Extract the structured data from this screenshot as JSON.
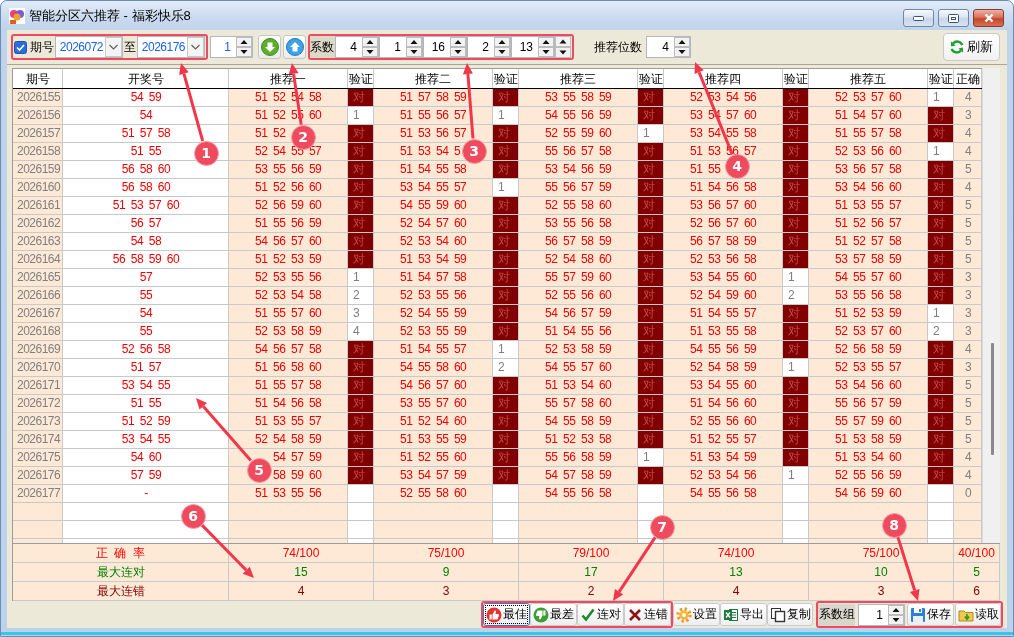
{
  "window": {
    "title": "智能分区六推荐 - 福彩快乐8"
  },
  "toolbar": {
    "period_filter": {
      "checked": true,
      "label": "期号",
      "from": "2026072",
      "to_label": "至",
      "to": "2026176"
    },
    "step": "1",
    "coefficients": {
      "label": "系数",
      "values": [
        "4",
        "1",
        "16",
        "2",
        "13"
      ]
    },
    "digits": {
      "label": "推荐位数",
      "value": "4"
    },
    "refresh_button": "刷新"
  },
  "table": {
    "columns": [
      "期号",
      "开奖号",
      "推荐一",
      "验证",
      "推荐二",
      "验证",
      "推荐三",
      "验证",
      "推荐四",
      "验证",
      "推荐五",
      "验证",
      "正确"
    ],
    "rows": [
      {
        "period": "2026155",
        "draw": "54 59",
        "picks": [
          {
            "numbers": "51 52 54 58",
            "check": "对",
            "hit": true
          },
          {
            "numbers": "51 57 58 59",
            "check": "对",
            "hit": true
          },
          {
            "numbers": "53 55 58 59",
            "check": "对",
            "hit": true
          },
          {
            "numbers": "52 53 54 56",
            "check": "对",
            "hit": true
          },
          {
            "numbers": "52 53 57 60",
            "check": "1",
            "hit": false
          }
        ],
        "correct": "4"
      },
      {
        "period": "2026156",
        "draw": "54",
        "picks": [
          {
            "numbers": "51 52 55 60",
            "check": "1",
            "hit": false
          },
          {
            "numbers": "51 55 56 57",
            "check": "1",
            "hit": false
          },
          {
            "numbers": "54 55 56 59",
            "check": "对",
            "hit": true
          },
          {
            "numbers": "53 54 57 60",
            "check": "对",
            "hit": true
          },
          {
            "numbers": "51 54 57 60",
            "check": "对",
            "hit": true
          }
        ],
        "correct": "3"
      },
      {
        "period": "2026157",
        "draw": "51 57 58",
        "picks": [
          {
            "numbers": "51 52",
            "check": "对",
            "hit": true
          },
          {
            "numbers": "51 53 56 57",
            "check": "对",
            "hit": true
          },
          {
            "numbers": "52 55 59 60",
            "check": "1",
            "hit": false
          },
          {
            "numbers": "53 54 55 58",
            "check": "对",
            "hit": true
          },
          {
            "numbers": "51 55 57 58",
            "check": "对",
            "hit": true
          }
        ],
        "correct": "4"
      },
      {
        "period": "2026158",
        "draw": "51 55",
        "picks": [
          {
            "numbers": "52 54 55 57",
            "check": "对",
            "hit": true
          },
          {
            "numbers": "51 53 54 5",
            "check": "对",
            "hit": true
          },
          {
            "numbers": "55 56 57 58",
            "check": "对",
            "hit": true
          },
          {
            "numbers": "51 53 56 57",
            "check": "对",
            "hit": true
          },
          {
            "numbers": "52 53 56 60",
            "check": "1",
            "hit": false
          }
        ],
        "correct": "4"
      },
      {
        "period": "2026159",
        "draw": "56 58 60",
        "picks": [
          {
            "numbers": "53 55 56 59",
            "check": "对",
            "hit": true
          },
          {
            "numbers": "51 54 55 58",
            "check": "对",
            "hit": true
          },
          {
            "numbers": "53 54 56 59",
            "check": "对",
            "hit": true
          },
          {
            "numbers": "51 55",
            "check": "对",
            "hit": true
          },
          {
            "numbers": "53 56 57 58",
            "check": "对",
            "hit": true
          }
        ],
        "correct": "5"
      },
      {
        "period": "2026160",
        "draw": "56 58 60",
        "picks": [
          {
            "numbers": "51 52 56 60",
            "check": "对",
            "hit": true
          },
          {
            "numbers": "53 54 55 57",
            "check": "1",
            "hit": false
          },
          {
            "numbers": "55 56 57 59",
            "check": "对",
            "hit": true
          },
          {
            "numbers": "51 54 56 58",
            "check": "对",
            "hit": true
          },
          {
            "numbers": "53 54 56 60",
            "check": "对",
            "hit": true
          }
        ],
        "correct": "4"
      },
      {
        "period": "2026161",
        "draw": "51 53 57 60",
        "picks": [
          {
            "numbers": "52 56 59 60",
            "check": "对",
            "hit": true
          },
          {
            "numbers": "54 55 59 60",
            "check": "对",
            "hit": true
          },
          {
            "numbers": "52 55 58 60",
            "check": "对",
            "hit": true
          },
          {
            "numbers": "53 56 57 60",
            "check": "对",
            "hit": true
          },
          {
            "numbers": "51 53 55 57",
            "check": "对",
            "hit": true
          }
        ],
        "correct": "5"
      },
      {
        "period": "2026162",
        "draw": "56 57",
        "picks": [
          {
            "numbers": "51 55 56 59",
            "check": "对",
            "hit": true
          },
          {
            "numbers": "52 54 57 60",
            "check": "对",
            "hit": true
          },
          {
            "numbers": "53 55 56 58",
            "check": "对",
            "hit": true
          },
          {
            "numbers": "52 56 57 60",
            "check": "对",
            "hit": true
          },
          {
            "numbers": "51 52 56 57",
            "check": "对",
            "hit": true
          }
        ],
        "correct": "5"
      },
      {
        "period": "2026163",
        "draw": "54 58",
        "picks": [
          {
            "numbers": "54 56 57 60",
            "check": "对",
            "hit": true
          },
          {
            "numbers": "52 53 54 60",
            "check": "对",
            "hit": true
          },
          {
            "numbers": "56 57 58 59",
            "check": "对",
            "hit": true
          },
          {
            "numbers": "56 57 58 59",
            "check": "对",
            "hit": true
          },
          {
            "numbers": "51 52 57 58",
            "check": "对",
            "hit": true
          }
        ],
        "correct": "5"
      },
      {
        "period": "2026164",
        "draw": "56 58 59 60",
        "picks": [
          {
            "numbers": "51 52 53 59",
            "check": "对",
            "hit": true
          },
          {
            "numbers": "51 53 54 59",
            "check": "对",
            "hit": true
          },
          {
            "numbers": "52 54 58 60",
            "check": "对",
            "hit": true
          },
          {
            "numbers": "52 53 56 58",
            "check": "对",
            "hit": true
          },
          {
            "numbers": "53 57 58 59",
            "check": "对",
            "hit": true
          }
        ],
        "correct": "5"
      },
      {
        "period": "2026165",
        "draw": "57",
        "picks": [
          {
            "numbers": "52 53 55 56",
            "check": "1",
            "hit": false
          },
          {
            "numbers": "51 54 57 58",
            "check": "对",
            "hit": true
          },
          {
            "numbers": "55 57 59 60",
            "check": "对",
            "hit": true
          },
          {
            "numbers": "53 54 55 60",
            "check": "1",
            "hit": false
          },
          {
            "numbers": "54 55 57 60",
            "check": "对",
            "hit": true
          }
        ],
        "correct": "3"
      },
      {
        "period": "2026166",
        "draw": "55",
        "picks": [
          {
            "numbers": "52 53 54 58",
            "check": "2",
            "hit": false
          },
          {
            "numbers": "52 53 55 56",
            "check": "对",
            "hit": true
          },
          {
            "numbers": "52 55 56 60",
            "check": "对",
            "hit": true
          },
          {
            "numbers": "52 54 59 60",
            "check": "2",
            "hit": false
          },
          {
            "numbers": "53 55 56 58",
            "check": "对",
            "hit": true
          }
        ],
        "correct": "3"
      },
      {
        "period": "2026167",
        "draw": "54",
        "picks": [
          {
            "numbers": "51 55 57 60",
            "check": "3",
            "hit": false
          },
          {
            "numbers": "52 54 55 59",
            "check": "对",
            "hit": true
          },
          {
            "numbers": "54 56 57 59",
            "check": "对",
            "hit": true
          },
          {
            "numbers": "51 54 55 57",
            "check": "对",
            "hit": true
          },
          {
            "numbers": "51 52 53 59",
            "check": "1",
            "hit": false
          }
        ],
        "correct": "3"
      },
      {
        "period": "2026168",
        "draw": "55",
        "picks": [
          {
            "numbers": "52 53 58 59",
            "check": "4",
            "hit": false
          },
          {
            "numbers": "52 53 55 59",
            "check": "对",
            "hit": true
          },
          {
            "numbers": "51 54 55 56",
            "check": "对",
            "hit": true
          },
          {
            "numbers": "51 53 55 58",
            "check": "对",
            "hit": true
          },
          {
            "numbers": "52 53 57 60",
            "check": "2",
            "hit": false
          }
        ],
        "correct": "3"
      },
      {
        "period": "2026169",
        "draw": "52 56 58",
        "picks": [
          {
            "numbers": "54 56 57 58",
            "check": "对",
            "hit": true
          },
          {
            "numbers": "51 54 55 57",
            "check": "1",
            "hit": false
          },
          {
            "numbers": "52 53 58 59",
            "check": "对",
            "hit": true
          },
          {
            "numbers": "54 55 56 59",
            "check": "对",
            "hit": true
          },
          {
            "numbers": "52 56 58 59",
            "check": "对",
            "hit": true
          }
        ],
        "correct": "4"
      },
      {
        "period": "2026170",
        "draw": "51 57",
        "picks": [
          {
            "numbers": "51 56 58 60",
            "check": "对",
            "hit": true
          },
          {
            "numbers": "54 55 58 60",
            "check": "2",
            "hit": false
          },
          {
            "numbers": "54 55 57 60",
            "check": "对",
            "hit": true
          },
          {
            "numbers": "52 54 58 59",
            "check": "1",
            "hit": false
          },
          {
            "numbers": "52 53 55 57",
            "check": "对",
            "hit": true
          }
        ],
        "correct": "3"
      },
      {
        "period": "2026171",
        "draw": "53 54 55",
        "picks": [
          {
            "numbers": "51 55 57 58",
            "check": "对",
            "hit": true
          },
          {
            "numbers": "54 56 57 60",
            "check": "对",
            "hit": true
          },
          {
            "numbers": "51 53 54 60",
            "check": "对",
            "hit": true
          },
          {
            "numbers": "53 54 55 60",
            "check": "对",
            "hit": true
          },
          {
            "numbers": "53 54 56 60",
            "check": "对",
            "hit": true
          }
        ],
        "correct": "5"
      },
      {
        "period": "2026172",
        "draw": "51 55",
        "picks": [
          {
            "numbers": "51 54 56 58",
            "check": "对",
            "hit": true
          },
          {
            "numbers": "53 55 57 60",
            "check": "对",
            "hit": true
          },
          {
            "numbers": "55 57 58 60",
            "check": "对",
            "hit": true
          },
          {
            "numbers": "51 54 56 60",
            "check": "对",
            "hit": true
          },
          {
            "numbers": "55 56 57 59",
            "check": "对",
            "hit": true
          }
        ],
        "correct": "5"
      },
      {
        "period": "2026173",
        "draw": "51 52 59",
        "picks": [
          {
            "numbers": "51 53 55 57",
            "check": "对",
            "hit": true
          },
          {
            "numbers": "51 52 54 60",
            "check": "对",
            "hit": true
          },
          {
            "numbers": "54 55 58 59",
            "check": "对",
            "hit": true
          },
          {
            "numbers": "52 55 56 60",
            "check": "对",
            "hit": true
          },
          {
            "numbers": "55 57 59 60",
            "check": "对",
            "hit": true
          }
        ],
        "correct": "5"
      },
      {
        "period": "2026174",
        "draw": "53 54 55",
        "picks": [
          {
            "numbers": "52 54 58 59",
            "check": "对",
            "hit": true
          },
          {
            "numbers": "51 53 55 59",
            "check": "对",
            "hit": true
          },
          {
            "numbers": "51 52 53 58",
            "check": "对",
            "hit": true
          },
          {
            "numbers": "51 52 55 57",
            "check": "对",
            "hit": true
          },
          {
            "numbers": "51 53 58 59",
            "check": "对",
            "hit": true
          }
        ],
        "correct": "5"
      },
      {
        "period": "2026175",
        "draw": "54 60",
        "picks": [
          {
            "numbers": "54 57 59",
            "check": "对",
            "hit": true,
            "covered_start": true
          },
          {
            "numbers": "51 52 55 60",
            "check": "对",
            "hit": true
          },
          {
            "numbers": "55 56 58 59",
            "check": "1",
            "hit": false
          },
          {
            "numbers": "51 53 54 59",
            "check": "对",
            "hit": true
          },
          {
            "numbers": "51 53 54 60",
            "check": "对",
            "hit": true
          }
        ],
        "correct": "4"
      },
      {
        "period": "2026176",
        "draw": "57 59",
        "picks": [
          {
            "numbers": "58 59 60",
            "check": "对",
            "hit": true,
            "covered_start": true
          },
          {
            "numbers": "53 54 57 59",
            "check": "对",
            "hit": true
          },
          {
            "numbers": "54 57 58 59",
            "check": "对",
            "hit": true
          },
          {
            "numbers": "52 53 54 56",
            "check": "1",
            "hit": false
          },
          {
            "numbers": "52 55 56 59",
            "check": "对",
            "hit": true
          }
        ],
        "correct": "4"
      },
      {
        "period": "2026177",
        "draw": "-",
        "picks": [
          {
            "numbers": "51 53 55 56"
          },
          {
            "numbers": "52 55 58 60"
          },
          {
            "numbers": "54 55 56 58"
          },
          {
            "numbers": "54 55 56 58"
          },
          {
            "numbers": "54 56 59 60"
          }
        ],
        "correct": "0"
      }
    ]
  },
  "summary": [
    {
      "label": "正 确 率",
      "kind": "accuracy",
      "values": [
        "74/100",
        "75/100",
        "79/100",
        "74/100",
        "75/100",
        "40/100"
      ]
    },
    {
      "label": "最大连对",
      "kind": "max_hit_streak",
      "values": [
        "15",
        "9",
        "17",
        "13",
        "10",
        "5"
      ]
    },
    {
      "label": "最大连错",
      "kind": "max_miss_streak",
      "values": [
        "4",
        "3",
        "2",
        "4",
        "3",
        "6"
      ]
    }
  ],
  "bottom_bar": {
    "buttons": [
      {
        "kind": "best",
        "label": "最佳",
        "focused": true
      },
      {
        "kind": "worst",
        "label": "最差",
        "focused": false
      },
      {
        "kind": "hit_streak",
        "label": "连对",
        "focused": false
      },
      {
        "kind": "miss_streak",
        "label": "连错",
        "focused": false
      },
      {
        "kind": "settings",
        "label": "设置",
        "focused": false
      },
      {
        "kind": "export",
        "label": "导出",
        "focused": false
      },
      {
        "kind": "copy",
        "label": "复制",
        "focused": false
      }
    ],
    "coefficient_group": {
      "label": "系数组",
      "value": "1"
    },
    "file_buttons": [
      {
        "kind": "save",
        "label": "保存"
      },
      {
        "kind": "load",
        "label": "读取"
      }
    ]
  },
  "callouts": [
    "1",
    "2",
    "3",
    "4",
    "5",
    "6",
    "7",
    "8"
  ]
}
